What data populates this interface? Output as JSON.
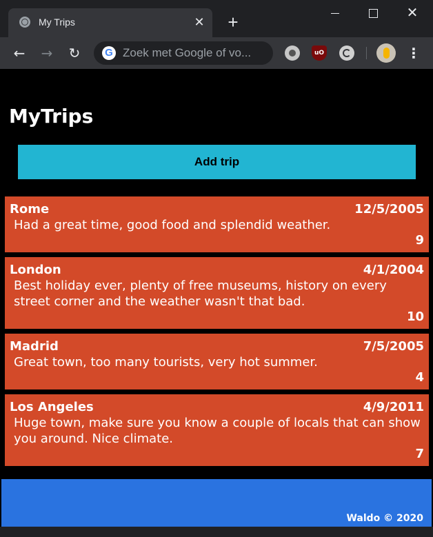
{
  "browser": {
    "tab_title": "My Trips",
    "tab_close": "✕",
    "new_tab": "+",
    "omnibox_placeholder": "Zoek met Google of vo...",
    "window_close": "✕"
  },
  "icons": {
    "tab": "globe-icon",
    "back": "arrow-left-icon",
    "forward": "arrow-right-icon",
    "reload": "reload-icon",
    "search": "google-icon",
    "extensions": [
      "extension-icon",
      "ublock-icon",
      "extension-icon"
    ],
    "profile": "avatar",
    "menu": "more-vert-icon"
  },
  "colors": {
    "accent_button": "#22b5d2",
    "card": "#d34a29",
    "footer": "#2a73e0",
    "background": "#000000"
  },
  "app": {
    "title": "MyTrips",
    "add_button": "Add trip"
  },
  "trips": [
    {
      "name": "Rome",
      "date": "12/5/2005",
      "description": "Had a great time, good food and splendid weather.",
      "score": "9"
    },
    {
      "name": "London",
      "date": "4/1/2004",
      "description": "Best holiday ever, plenty of free museums, history on every street corner and the weather wasn't that bad.",
      "score": "10"
    },
    {
      "name": "Madrid",
      "date": "7/5/2005",
      "description": "Great town, too many tourists, very hot summer.",
      "score": "4"
    },
    {
      "name": "Los Angeles",
      "date": "4/9/2011",
      "description": "Huge town, make sure you know a couple of locals that can show you around. Nice climate.",
      "score": "7"
    }
  ],
  "footer": {
    "text": "Waldo © 2020"
  }
}
